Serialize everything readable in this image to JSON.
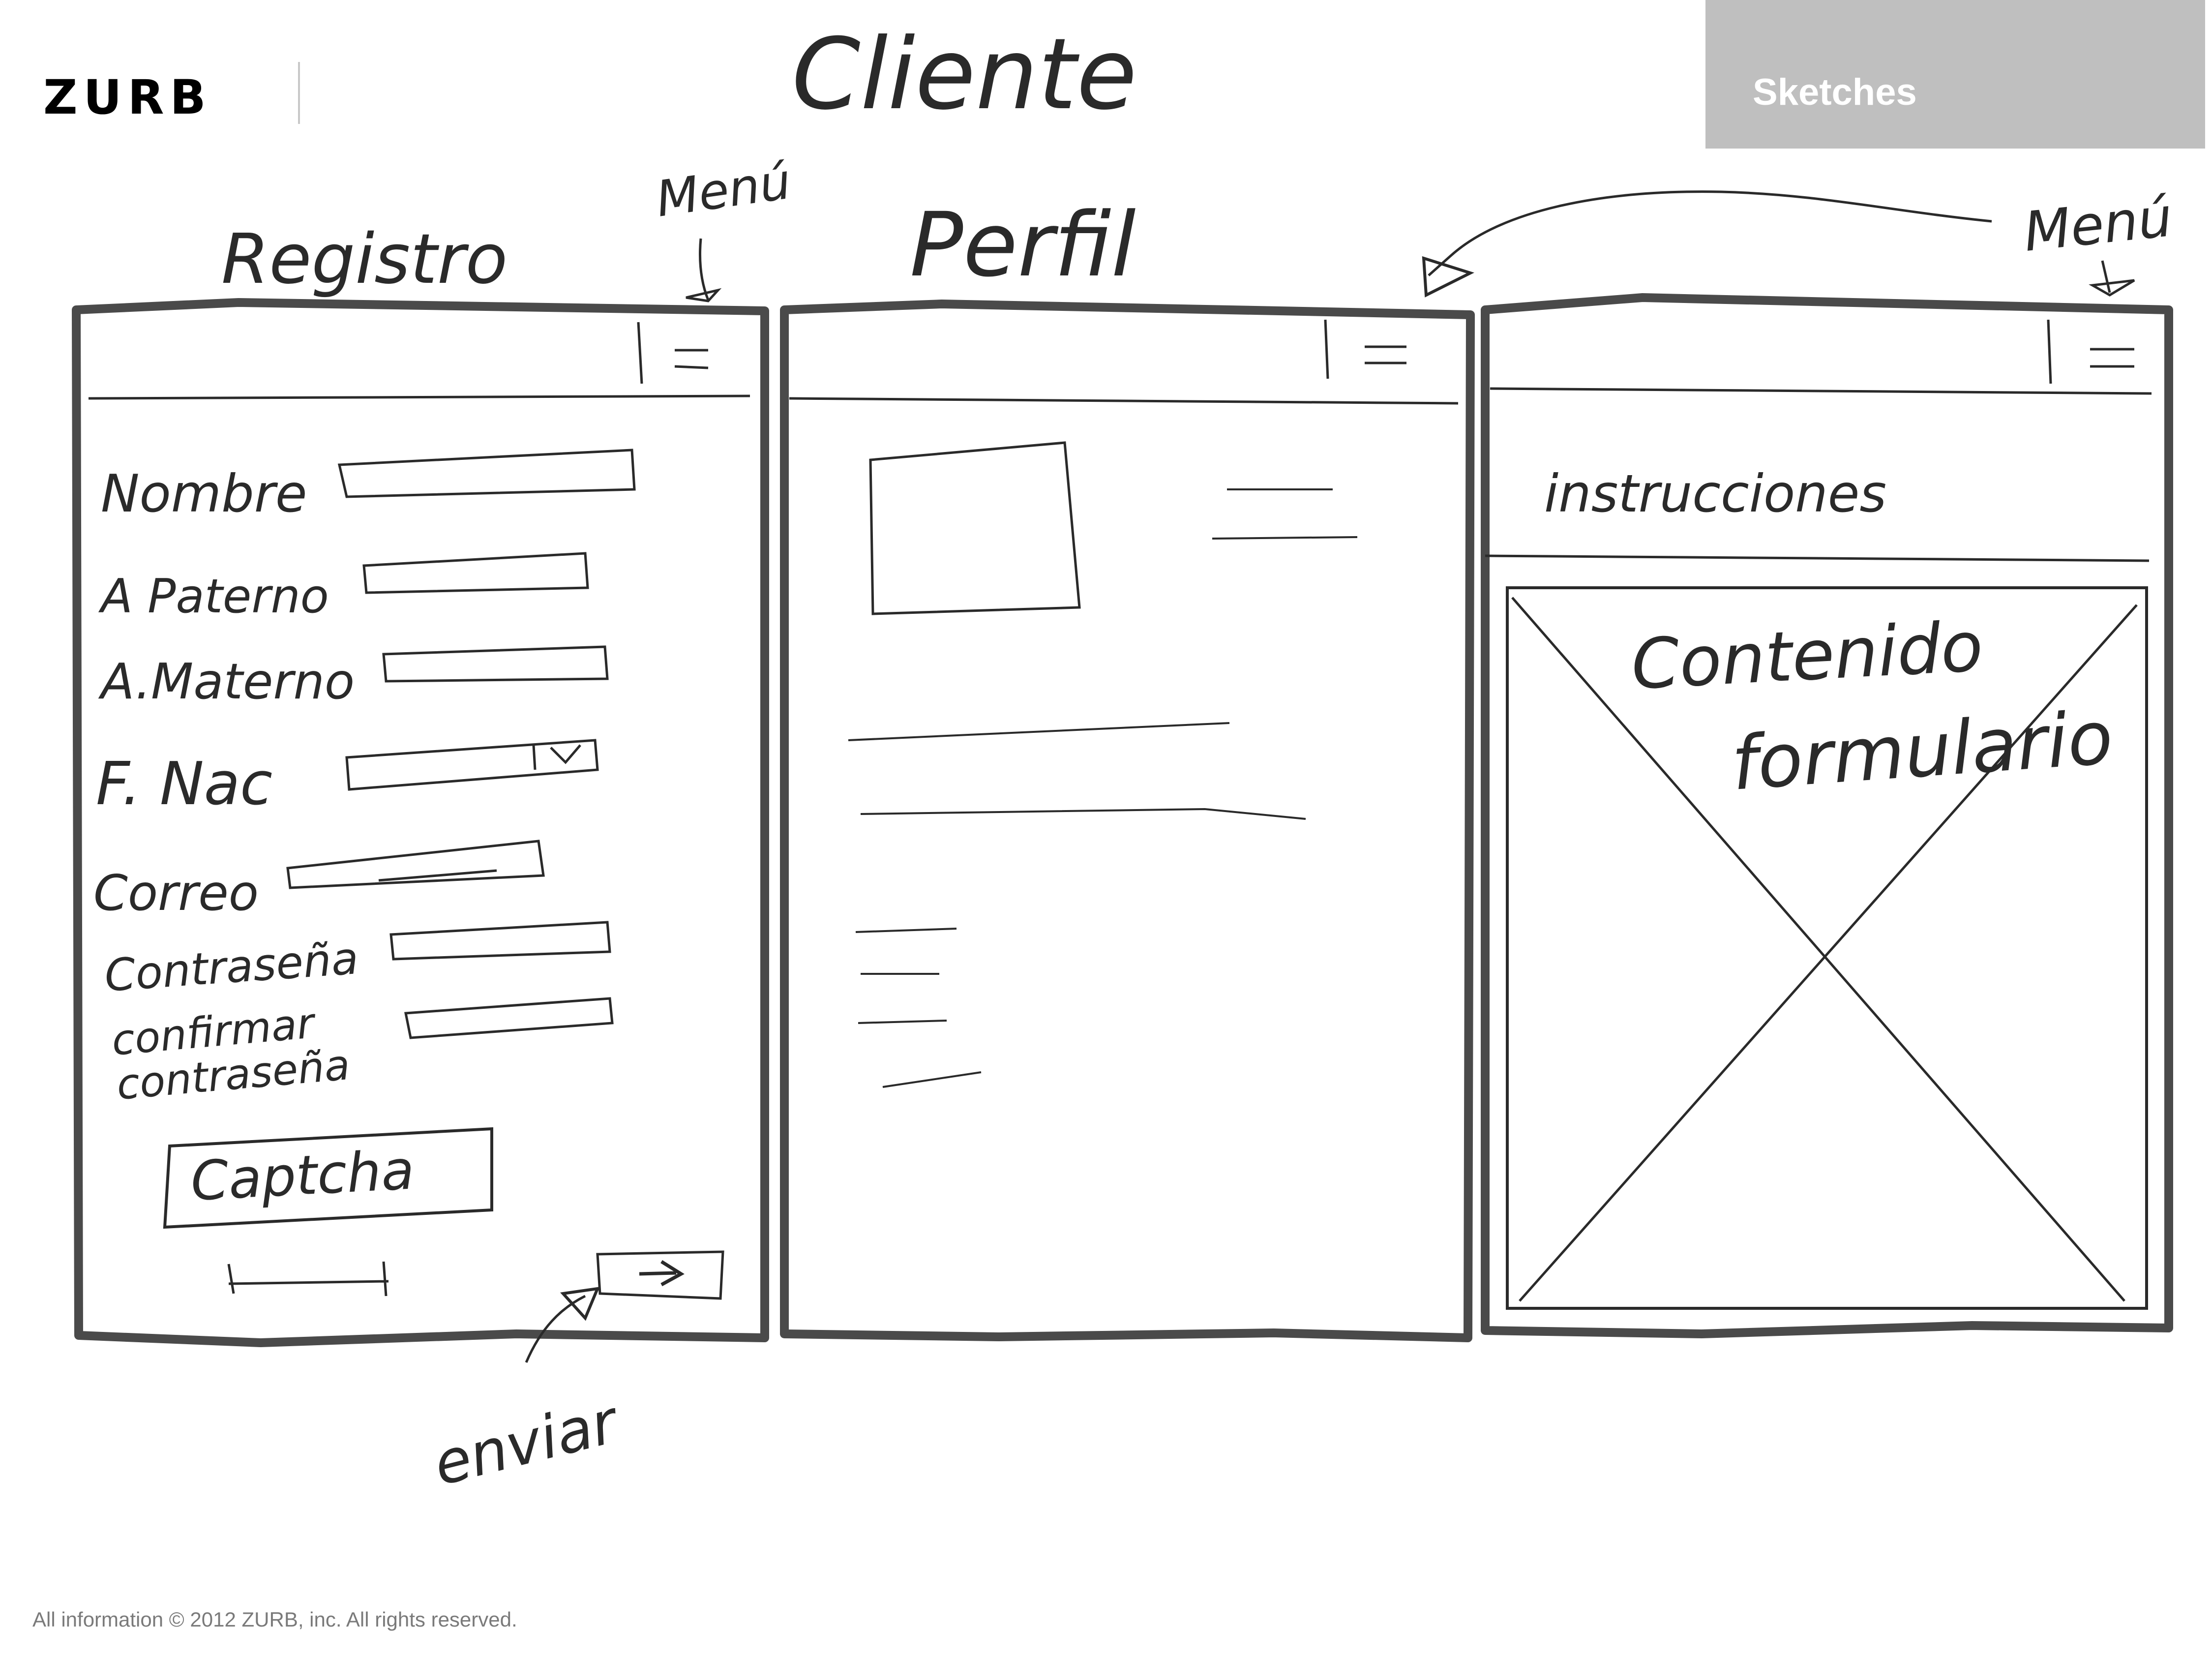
{
  "header": {
    "logo_text": "ZURB",
    "section_tab": "Sketches"
  },
  "sketch": {
    "title": "Cliente",
    "annotations": {
      "menu_left": "Menú",
      "menu_right": "Menú",
      "send": "enviar"
    },
    "registro": {
      "title": "Registro",
      "fields": [
        "Nombre",
        "A Paterno",
        "A.Materno",
        "F. Nac",
        "Correo",
        "Contraseña",
        "confirmar",
        "contraseña"
      ],
      "dropdown_icon": "chevron-down-icon",
      "captcha_label": "Captcha"
    },
    "perfil": {
      "title": "Perfil"
    },
    "formulario": {
      "instructions": "instrucciones",
      "content_line1": "Contenido",
      "content_line2": "formulario"
    }
  },
  "footer": {
    "copyright": "All information © 2012 ZURB, inc.  All rights reserved."
  },
  "colors": {
    "tab_background": "#bfbfbf",
    "frame_stroke": "#4a4a4a",
    "pencil": "#2a2a2a"
  }
}
